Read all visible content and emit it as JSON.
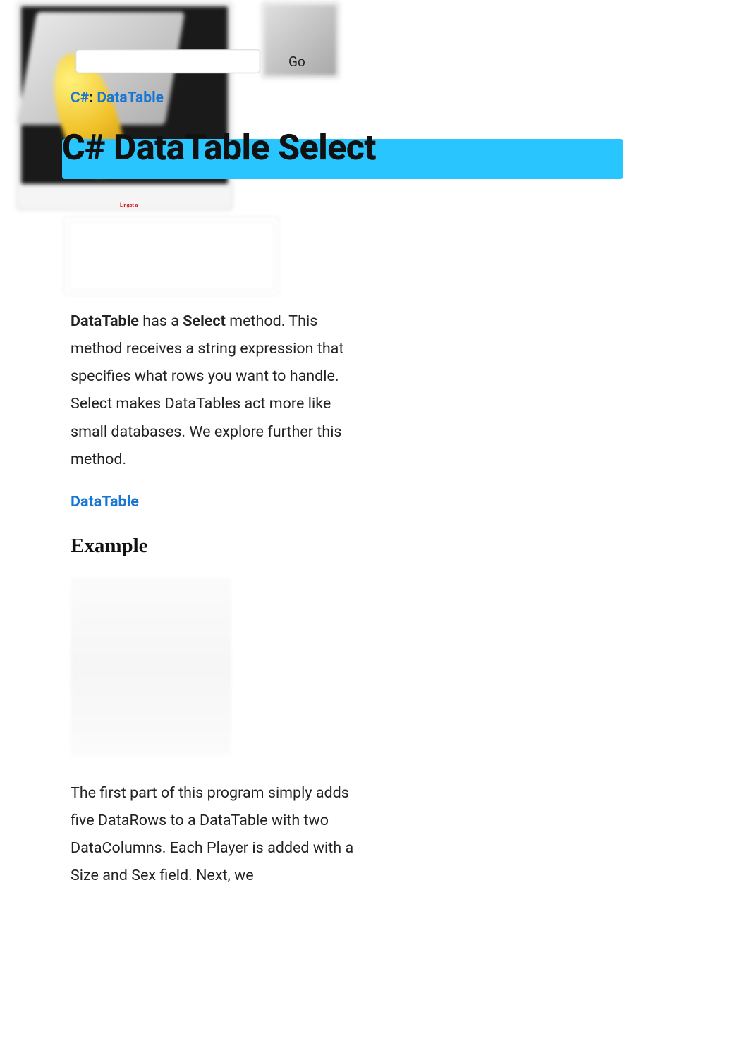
{
  "search": {
    "placeholder": "",
    "goLabel": "Go"
  },
  "breadcrumb": {
    "lang": "C#",
    "sep": ":",
    "topic": "DataTable"
  },
  "title": "C# DataTable Select",
  "tinyRed": "Lingot a",
  "intro": {
    "strong1": "DataTable",
    "mid1": " has a ",
    "strong2": "Select",
    "tail": " method. This method receives a string expression that specifies what rows you want to handle. Select makes DataTables act more like small databases. We explore further this method."
  },
  "link1": "DataTable",
  "heading1": "Example",
  "para2": "The first part of this program simply adds five DataRows to a DataTable with two DataColumns. Each Player is added with a Size and Sex field. Next, we"
}
